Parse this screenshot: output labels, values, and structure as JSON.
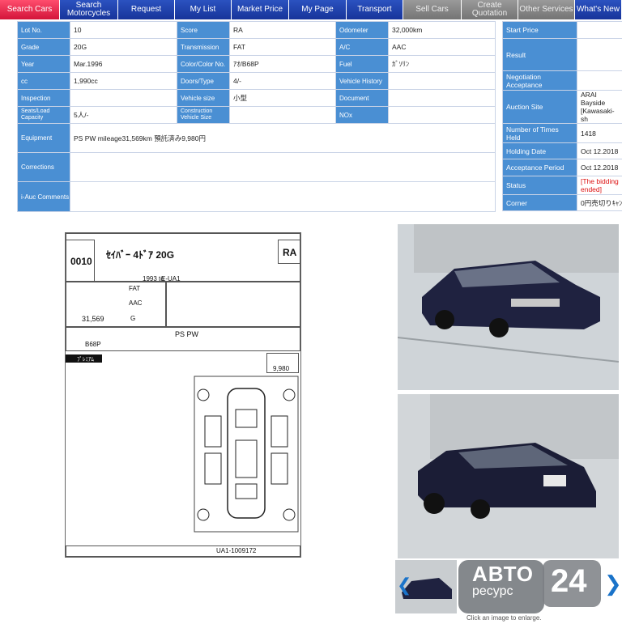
{
  "nav": {
    "items": [
      {
        "label": "Search Cars",
        "active": true
      },
      {
        "label": "Search Motorcycles"
      },
      {
        "label": "Request"
      },
      {
        "label": "My List"
      },
      {
        "label": "Market Price"
      },
      {
        "label": "My Page"
      },
      {
        "label": "Transport"
      },
      {
        "label": "Sell Cars",
        "muted": true
      },
      {
        "label": "Create Quotation",
        "muted": true
      },
      {
        "label": "Other Services",
        "muted": true
      },
      {
        "label": "What's New"
      }
    ]
  },
  "info": {
    "lot_no_label": "Lot No.",
    "lot_no": "10",
    "score_label": "Score",
    "score": "RA",
    "odometer_label": "Odometer",
    "odometer": "32,000km",
    "grade_label": "Grade",
    "grade": "20G",
    "transmission_label": "Transmission",
    "transmission": "FAT",
    "ac_label": "A/C",
    "ac": "AAC",
    "year_label": "Year",
    "year": "Mar.1996",
    "color_label": "Color/Color No.",
    "color": "ｱｵ/B68P",
    "fuel_label": "Fuel",
    "fuel": "ｶﾞｿﾘﾝ",
    "cc_label": "cc",
    "cc": "1,990cc",
    "doors_label": "Doors/Type",
    "doors": "4/-",
    "history_label": "Vehicle History",
    "history": "",
    "inspection_label": "Inspection",
    "inspection": "",
    "vsize_label": "Vehicle size",
    "vsize": "小型",
    "document_label": "Document",
    "document": "",
    "seats_label": "Seats/Load Capacity",
    "seats": "5人/-",
    "construction_label": "Construction Vehicle Size",
    "construction": "",
    "nox_label": "NOx",
    "nox": "",
    "equipment_label": "Equipment",
    "equipment": "PS PW mileage31,569km 預託済み9,980円",
    "corrections_label": "Corrections",
    "corrections": "",
    "iauc_label": "i-Auc Comments",
    "iauc": ""
  },
  "side": {
    "start_price_label": "Start Price",
    "start_price": "",
    "result_label": "Result",
    "result": "",
    "negotiation_label": "Negotiation Acceptance",
    "negotiation": "",
    "site_label": "Auction Site",
    "site": "ARAI Bayside [Kawasaki-sh",
    "times_label": "Number of Times Held",
    "times": "1418",
    "holding_label": "Holding Date",
    "holding": "Oct 12.2018",
    "acceptance_label": "Acceptance Period",
    "acceptance": "Oct 12.2018",
    "status_label": "Status",
    "status": "[The bidding ended]",
    "corner_label": "Corner",
    "corner": "0円売切りｷｬﾝ"
  },
  "sheet": {
    "lot": "0010",
    "model": "ｾｲﾊﾞｰ 4ﾄﾞｱ 20G",
    "score": "RA",
    "year_code": "1993 to",
    "model_code": "E-UA1",
    "shift": "FAT",
    "ac": "AAC",
    "km": "31,569",
    "grade": "G",
    "color": "B68P",
    "equipment": "PS  PW",
    "recycle": "9,980",
    "chassis": "UA1-1009172",
    "premium": "ﾌﾟﾚﾐｱﾑ"
  },
  "watermark": {
    "word": "АВТО",
    "word2": "ресурс",
    "digits": "24"
  },
  "caption": "Click an image to enlarge.",
  "colors": {
    "nav": "#1f3f9c",
    "active": "#e0204a",
    "key": "#4a8fd3",
    "muted": "#8a8a8a"
  }
}
